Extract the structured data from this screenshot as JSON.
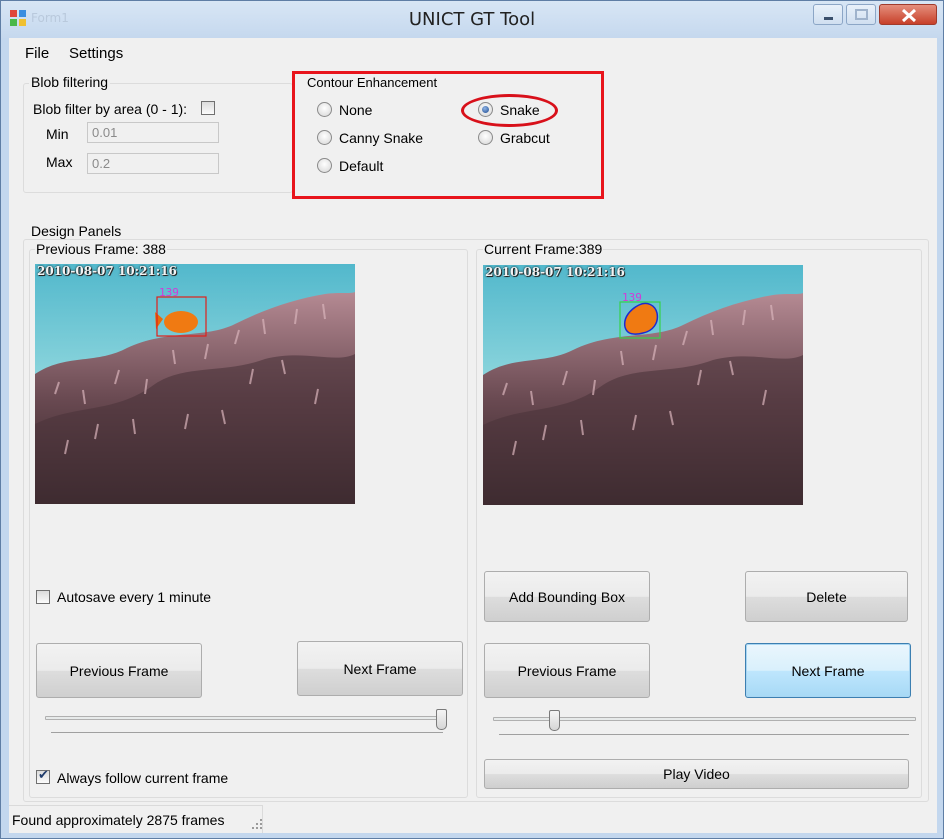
{
  "window": {
    "title": "UNICT GT Tool",
    "faded_title": "Form1",
    "controls": [
      "minimize-icon",
      "maximize-icon",
      "close-icon"
    ]
  },
  "menu": {
    "file": "File",
    "settings": "Settings"
  },
  "blob_filtering": {
    "label": "Blob filtering",
    "filter_label": "Blob filter by area (0 - 1):",
    "filter_checked": false,
    "min_label": "Min",
    "min_value": "0.01",
    "max_label": "Max",
    "max_value": "0.2"
  },
  "contour": {
    "label": "Contour Enhancement",
    "options": [
      "None",
      "Snake",
      "Canny Snake",
      "Grabcut",
      "Default"
    ],
    "selected": "Snake"
  },
  "design_panels": {
    "label": "Design Panels",
    "previous": {
      "label": "Previous Frame: 388",
      "timestamp": "2010-08-07 10:21:16",
      "box_id": "139",
      "autosave_label": "Autosave every 1 minute",
      "autosave_checked": false,
      "prev_button": "Previous Frame",
      "next_button": "Next Frame",
      "slider_position": 1.0,
      "follow_label": "Always follow current frame",
      "follow_checked": true
    },
    "current": {
      "label": "Current Frame:389",
      "timestamp": "2010-08-07 10:21:16",
      "box_id": "139",
      "add_bbox_button": "Add Bounding Box",
      "delete_button": "Delete",
      "prev_button": "Previous Frame",
      "next_button": "Next Frame",
      "slider_position": 0.14,
      "play_button": "Play Video"
    }
  },
  "status": {
    "text": "Found approximately 2875 frames"
  },
  "colors": {
    "annotation_red": "#e8141c",
    "bbox_red": "#e0201a",
    "bbox_green": "#36d24a",
    "snake_blue": "#1d2bd0",
    "id_magenta": "#d23ad8"
  }
}
